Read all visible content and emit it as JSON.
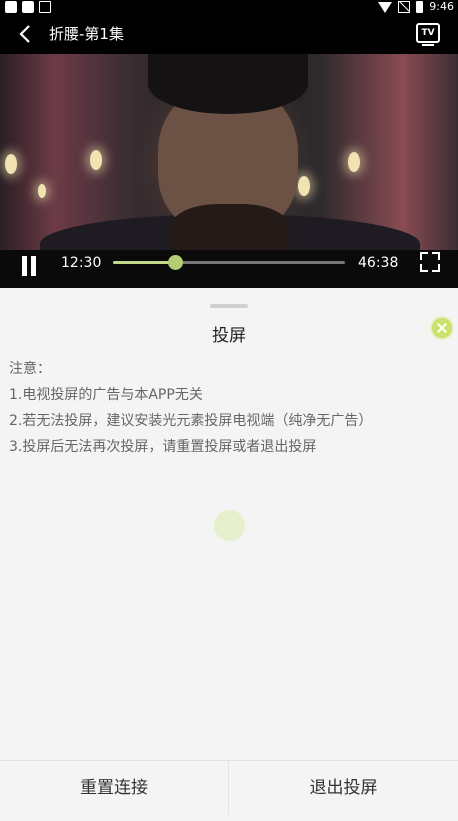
{
  "status_bar": {
    "time": "9:46"
  },
  "header": {
    "title": "折腰-第1集",
    "tv_label": "TV"
  },
  "player": {
    "current_time": "12:30",
    "total_time": "46:38",
    "progress": 0.268
  },
  "cast_sheet": {
    "title": "投屏",
    "notes": [
      "注意：",
      "1.电视投屏的广告与本APP无关",
      "2.若无法投屏，建议安装光元素投屏电视端（纯净无广告）",
      "3.投屏后无法再次投屏，请重置投屏或者退出投屏"
    ]
  },
  "footer": {
    "reset_label": "重置连接",
    "exit_label": "退出投屏"
  },
  "colors": {
    "accent": "#c8e26a",
    "progress": "#c5d98c"
  }
}
